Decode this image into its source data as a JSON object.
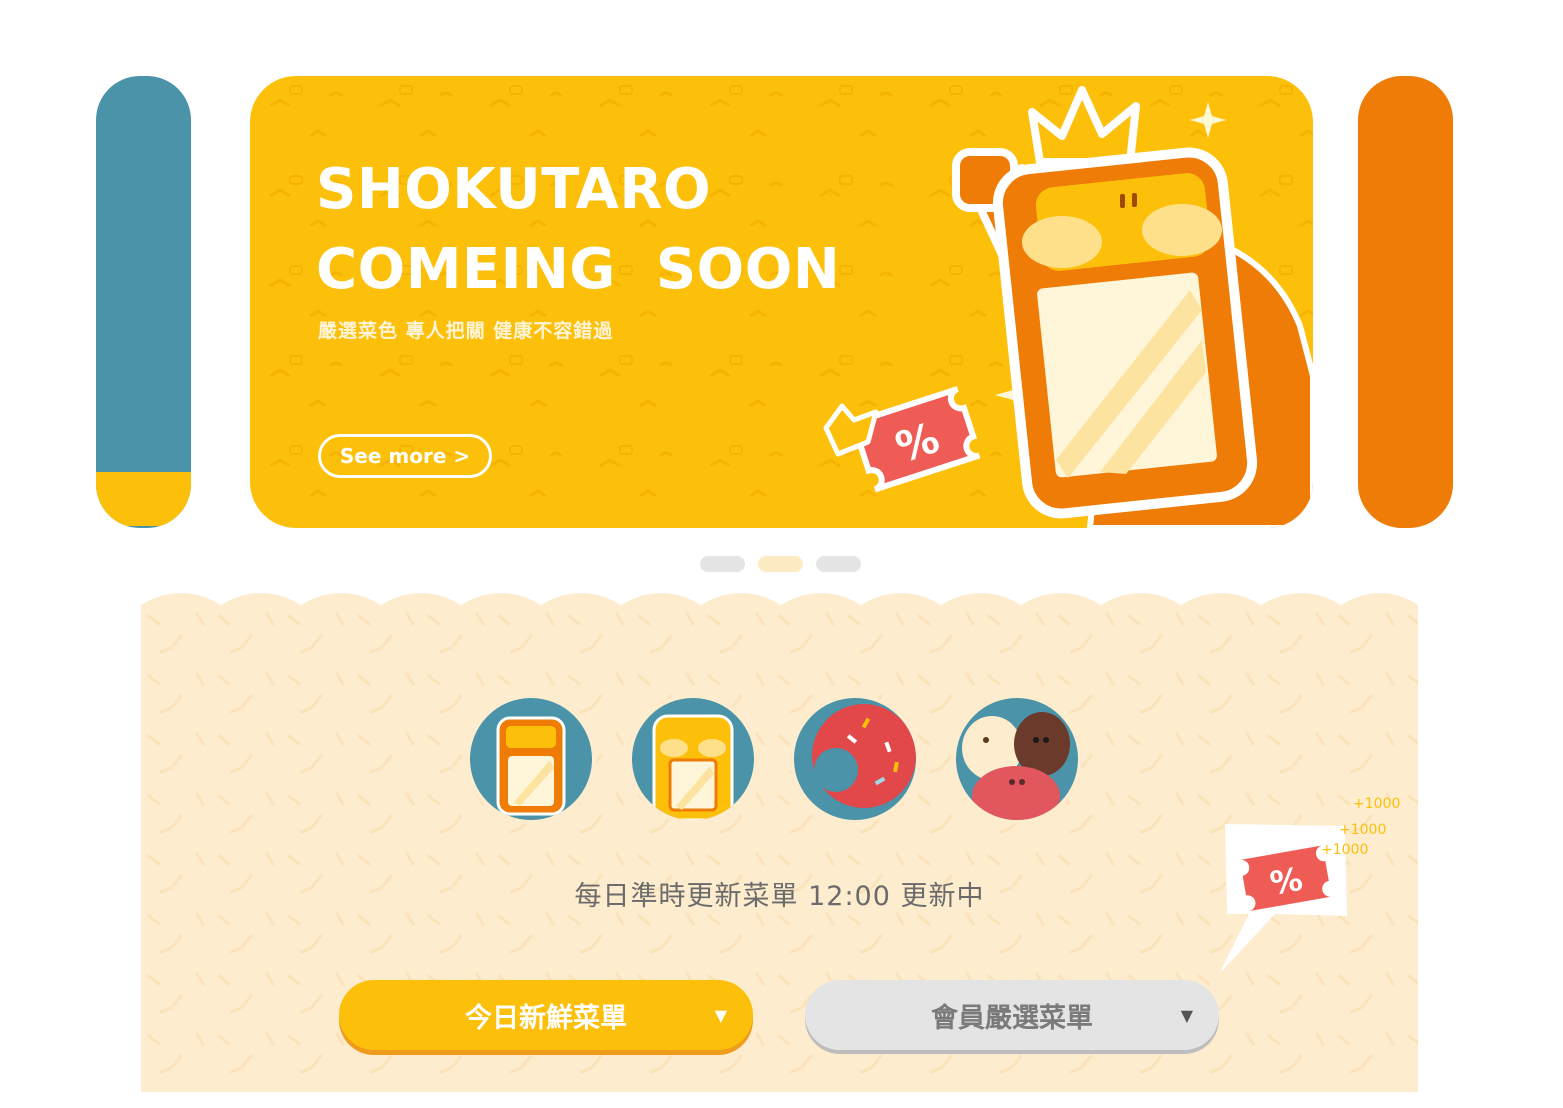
{
  "banner": {
    "title_line1": "SHOKUTARO",
    "title_line2": "COMEING  SOON",
    "subtitle": "嚴選菜色 專人把關 健康不容錯過",
    "see_more": "See more >",
    "coupon_symbol": "%"
  },
  "carousel": {
    "slide_count": 3,
    "active_index": 1
  },
  "menu": {
    "icons": [
      "mascot-icon",
      "mascot-face-icon",
      "donut-icon",
      "characters-icon"
    ],
    "caption": "每日準時更新菜單 12:00 更新中",
    "sticker_symbol": "%",
    "sticker_marks": [
      "+1000",
      "+1000",
      "+1000"
    ],
    "today_button": "今日新鮮菜單",
    "member_button": "會員嚴選菜單",
    "dropdown_arrow": "▼"
  },
  "colors": {
    "yellow": "#fcc00a",
    "orange": "#ee7c07",
    "teal": "#4a93a8",
    "cream": "#fdecce",
    "coupon_red": "#ef5b55"
  }
}
